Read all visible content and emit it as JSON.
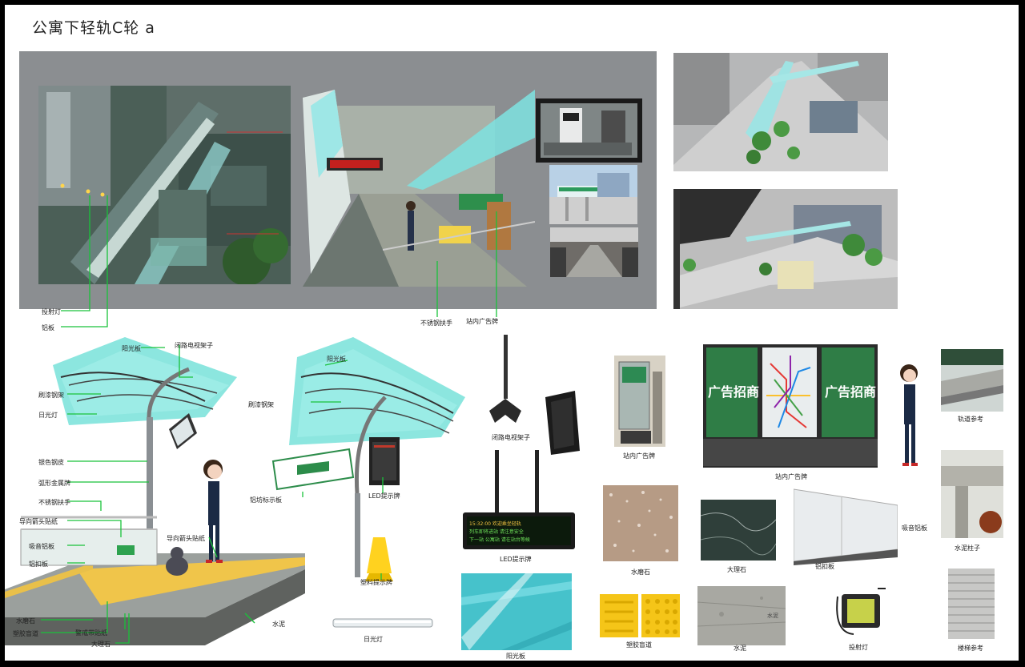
{
  "title": "公寓下轻轨C轮  a",
  "labels": {
    "top_tou_she_deng": "投射灯",
    "top_lv_ban": "铝板",
    "top_handrail": "不锈钢扶手",
    "top_ad_board": "站内广告牌",
    "canopy_yangguangban": "阳光板",
    "canopy_tv_rack": "闭路电视架子",
    "canopy_steel": "刷漆钢架",
    "canopy_daylight": "日光灯",
    "silver_steel": "银色钢皮",
    "arc_metal": "弧形金属牌",
    "steel_handrail": "不锈钢扶手",
    "arrow_sticker": "导向箭头贴纸",
    "sound_board": "吸音铝板",
    "buckle_board": "铝扣板",
    "terrazzo": "水磨石",
    "tactile_paving": "塑胶盲道",
    "warning_tape": "警戒带贴纸",
    "marble": "大理石",
    "cement": "水泥",
    "arrow_sticker_2": "导向箭头贴纸",
    "canopy2_yangguangban": "阳光板",
    "canopy2_steel": "刷漆钢架",
    "guide_sign": "铝坊标示板",
    "led_sign": "LED提示牌",
    "plastic_sign": "塑料提示牌",
    "fluorescent": "日光灯",
    "cctv_rack": "闭路电视架子",
    "led_board": "LED提示牌",
    "yangguang_panel": "阳光板",
    "ad_board_photo": "站内广告牌",
    "ad_board_big": "站内广告牌",
    "ad_text_left": "广告招商",
    "ad_text_right": "广告招商",
    "track_ref": "轨道参考",
    "concrete_column": "水泥柱子",
    "terrazzo_swatch": "水磨石",
    "marble_swatch": "大理石",
    "lv_ban_swatch": "铝扣板",
    "sound_panel": "吸音铝板",
    "tactile_swatch": "塑胶盲道",
    "cement_swatch": "水泥",
    "cement_note": "水泥",
    "spotlight": "投射灯",
    "stairs_ref": "楼梯参考",
    "led_text_l1": "15:32:00   欢迎乘坐轻轨",
    "led_text_l2": "列车即将进站 请注意安全",
    "led_text_l3": "下一站 公寓站 请在站台等候"
  }
}
